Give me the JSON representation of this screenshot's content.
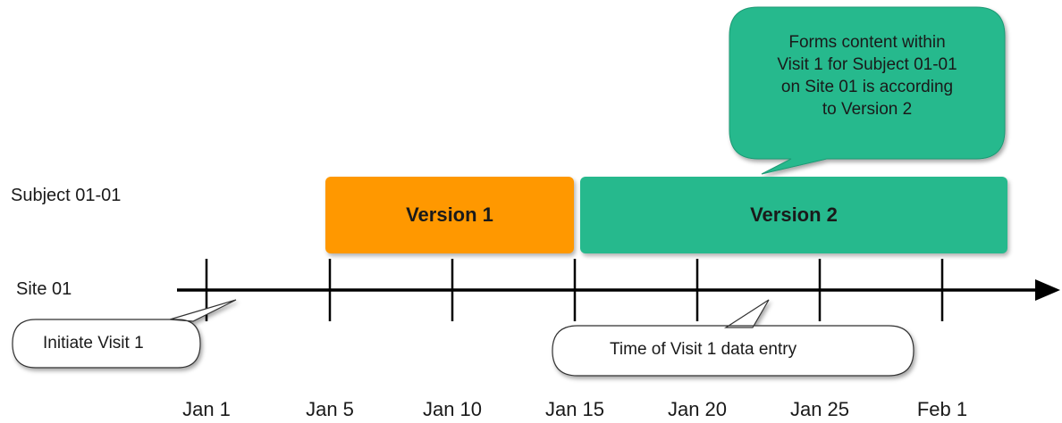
{
  "rows": {
    "subject_label": "Subject 01-01",
    "site_label": "Site 01"
  },
  "versions": [
    {
      "label": "Version 1",
      "color": "#ff9800"
    },
    {
      "label": "Version 2",
      "color": "#26b98d"
    }
  ],
  "ticks": [
    "Jan 1",
    "Jan 5",
    "Jan 10",
    "Jan 15",
    "Jan 20",
    "Jan 25",
    "Feb 1"
  ],
  "callouts": {
    "initiate": "Initiate Visit 1",
    "data_entry": "Time of Visit 1 data entry",
    "note_lines": [
      "Forms content within",
      "Visit 1 for Subject 01-01",
      "on Site 01 is according",
      "to Version 2"
    ]
  },
  "colors": {
    "note_bubble": "#26b98d",
    "axis": "#000000"
  }
}
